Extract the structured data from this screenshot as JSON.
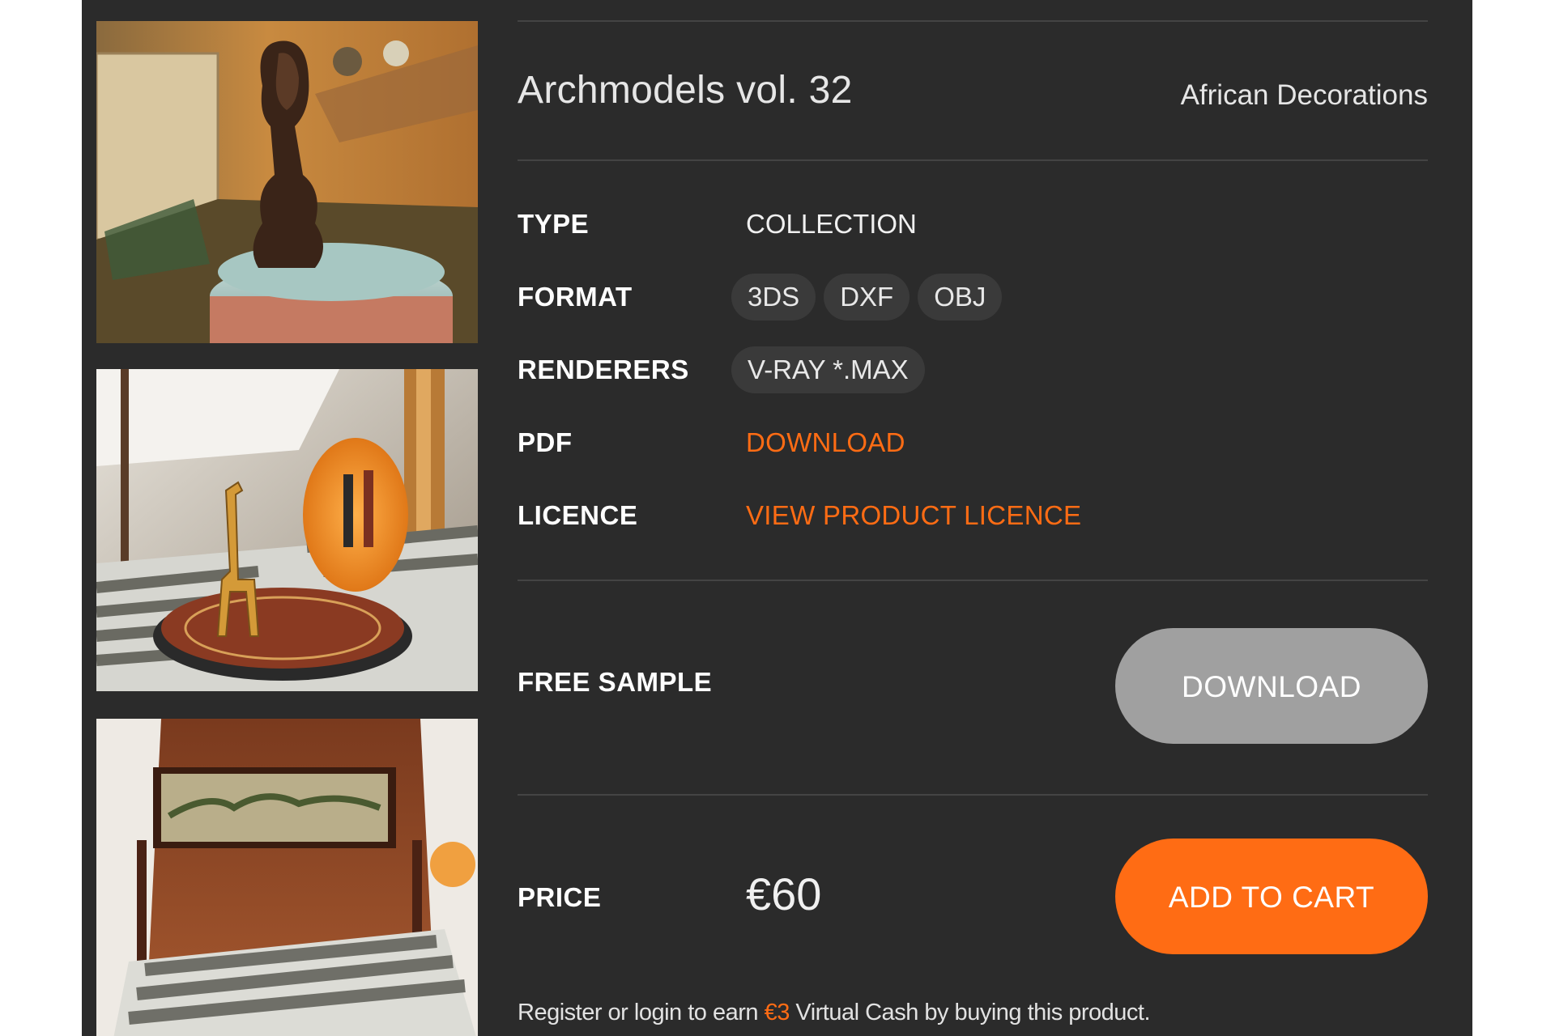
{
  "product": {
    "title": "Archmodels vol. 32",
    "subtitle": "African Decorations"
  },
  "details": {
    "type_label": "TYPE",
    "type_value": "COLLECTION",
    "format_label": "FORMAT",
    "formats": [
      "3DS",
      "DXF",
      "OBJ"
    ],
    "renderers_label": "RENDERERS",
    "renderers": [
      "V-RAY *.MAX"
    ],
    "pdf_label": "PDF",
    "pdf_link": "DOWNLOAD",
    "licence_label": "LICENCE",
    "licence_link": "VIEW PRODUCT LICENCE"
  },
  "sample": {
    "label": "FREE SAMPLE",
    "button": "DOWNLOAD"
  },
  "purchase": {
    "price_label": "PRICE",
    "price": "€60",
    "button": "ADD TO CART"
  },
  "note": {
    "before": "Register or login to earn ",
    "amount": "€3",
    "after": " Virtual Cash by buying this product."
  },
  "colors": {
    "panel_bg": "#2b2b2b",
    "accent": "#ff6c14",
    "chip_bg": "#3a3a3a",
    "sample_button": "#a0a0a0"
  },
  "icons": {
    "thumbnails": [
      "african-figurine-image",
      "giraffe-decoration-image",
      "bedroom-image"
    ]
  }
}
